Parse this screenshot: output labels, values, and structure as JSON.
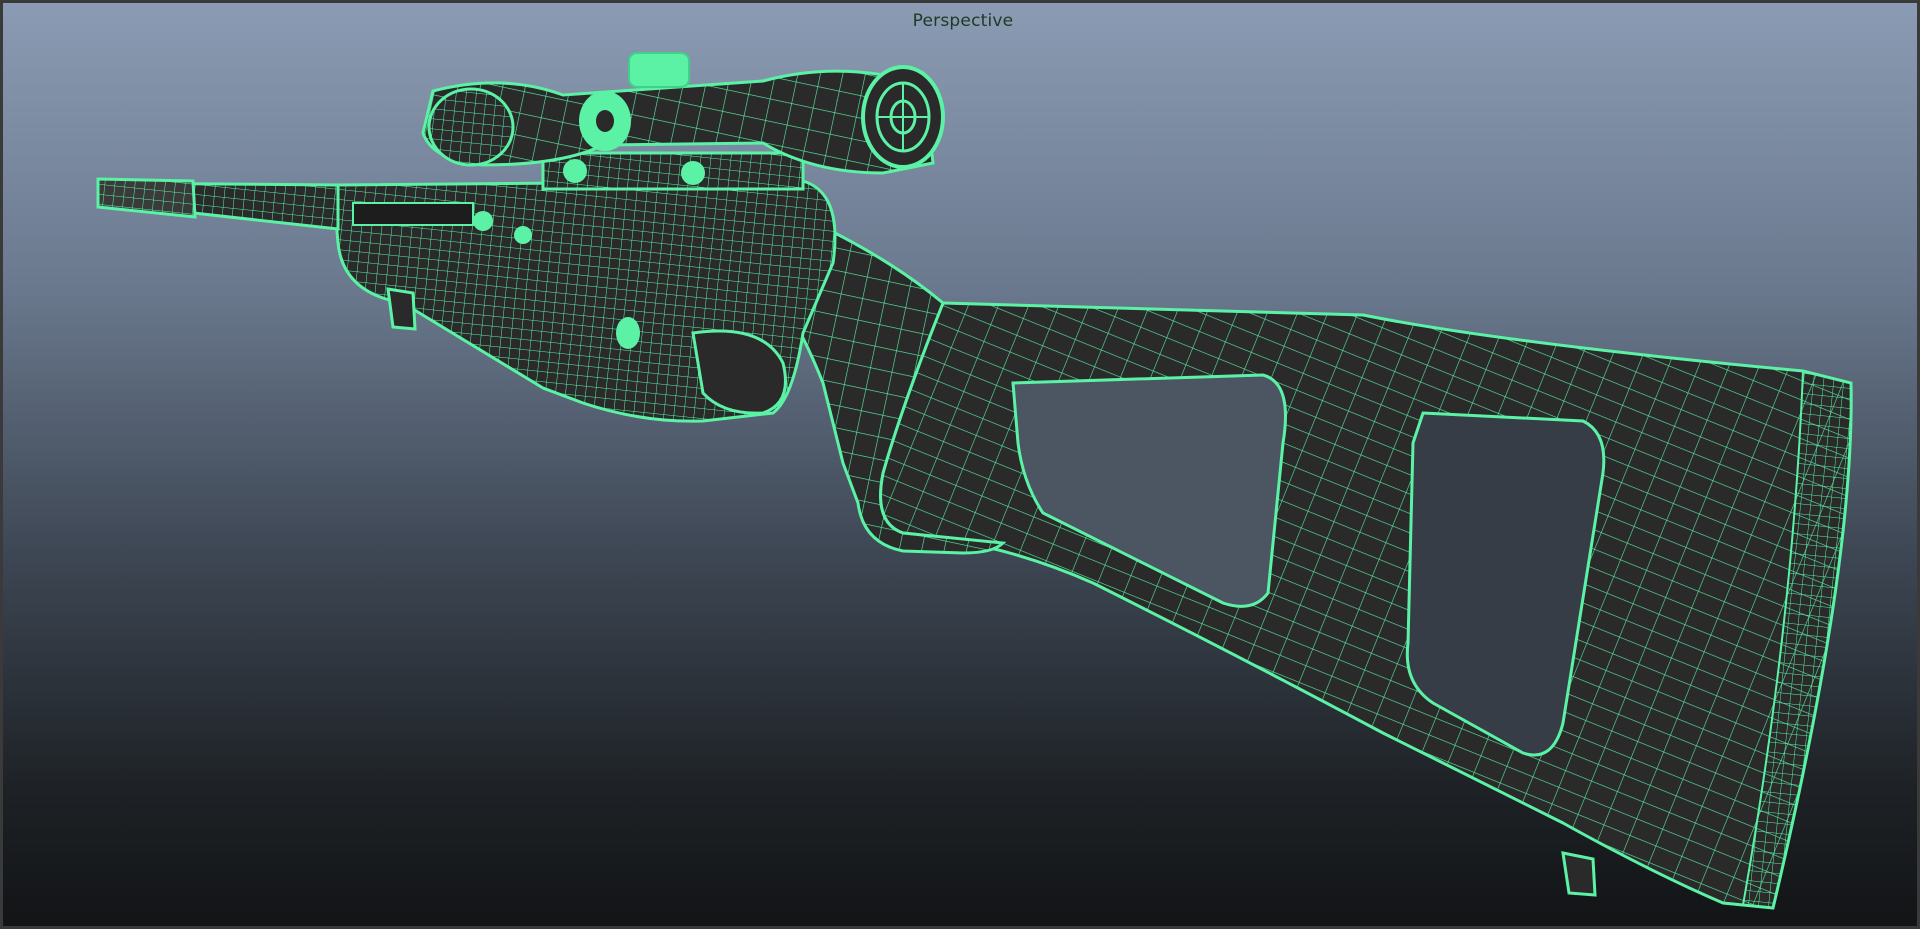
{
  "viewport": {
    "camera_label": "Perspective"
  },
  "model": {
    "wireframe_color": "#5bf2a6",
    "shaded_color": "#2a2a2a",
    "background_top": "#8b9bb3",
    "background_bottom": "#121416",
    "parts": [
      "scope",
      "barrel",
      "receiver",
      "trigger-guard",
      "pistol-grip",
      "stock",
      "bipod-foot"
    ]
  }
}
